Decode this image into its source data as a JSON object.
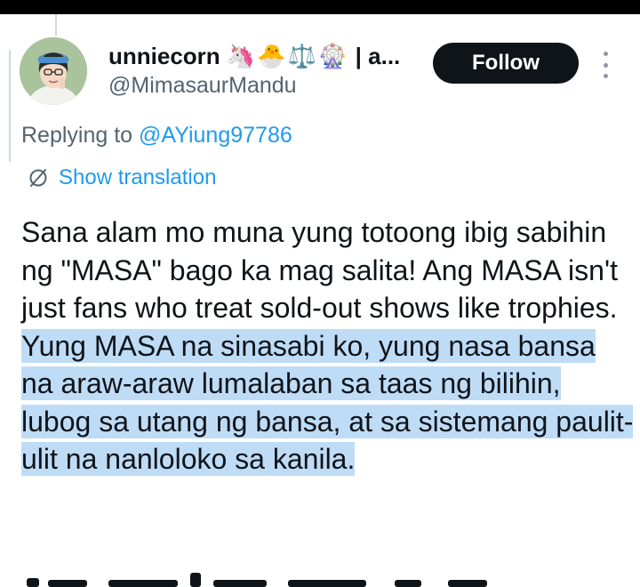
{
  "author": {
    "display_name": "unniecorn",
    "name_emojis": "🦄🐣⚖️🎡",
    "name_suffix": "| a...",
    "handle": "@MimasaurMandu"
  },
  "follow_label": "Follow",
  "reply": {
    "prefix": "Replying to ",
    "to_handle": "@AYiung97786"
  },
  "translation_label": "Show translation",
  "tweet": {
    "text_plain": "Sana alam mo muna yung totoong ibig sabihin ng \"MASA\" bago ka mag salita! Ang MASA isn't just fans who treat sold-out shows like trophies. ",
    "text_highlighted": "Yung MASA na sinasabi ko, yung nasa bansa na araw-araw lumalaban sa taas ng bilihin, lubog sa utang ng bansa, at sa sistemang paulit-ulit na nanloloko sa kanila."
  },
  "colors": {
    "accent": "#1d9bf0",
    "highlight": "#bfdcf7",
    "follow_button": "#0f1419"
  },
  "icons": {
    "more": "more-vertical-icon",
    "translation": "translate-icon"
  }
}
